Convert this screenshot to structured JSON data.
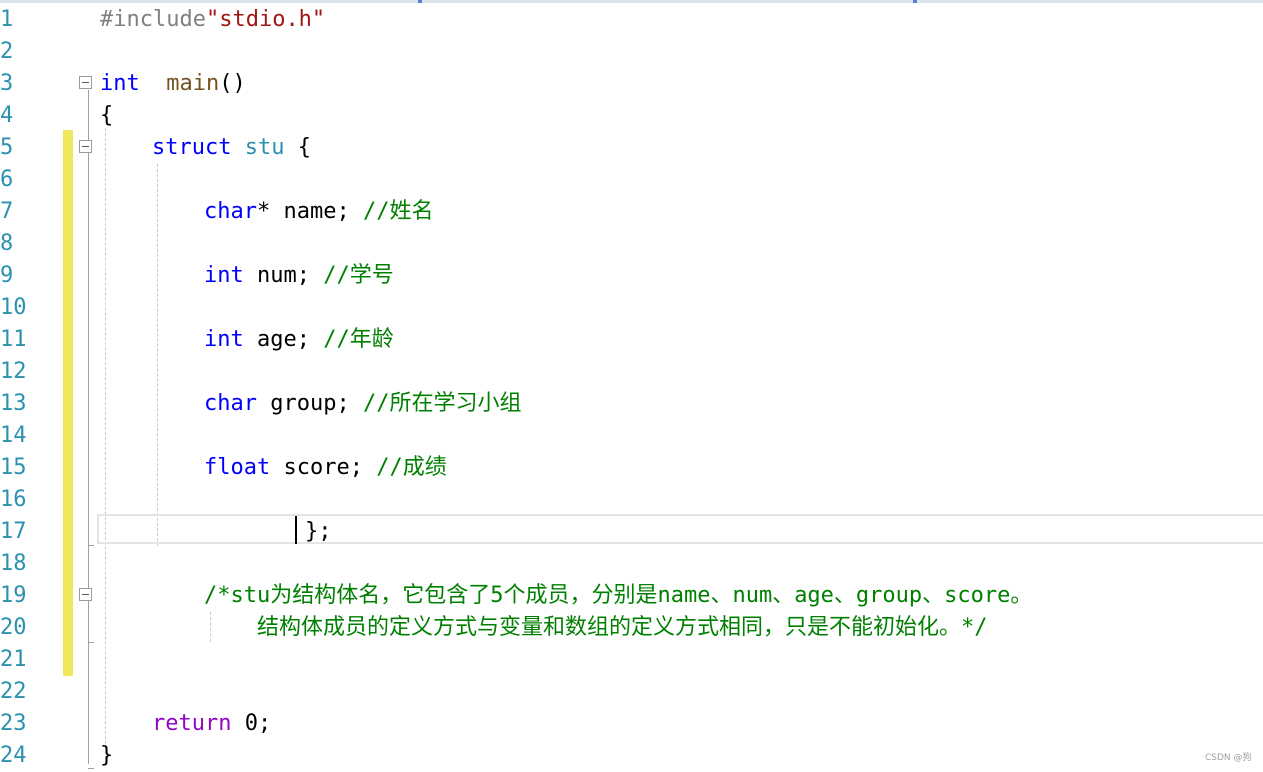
{
  "editor": {
    "line_numbers": [
      "1",
      "2",
      "3",
      "4",
      "5",
      "6",
      "7",
      "8",
      "9",
      "10",
      "11",
      "12",
      "13",
      "14",
      "15",
      "16",
      "17",
      "18",
      "19",
      "20",
      "21",
      "22",
      "23",
      "24"
    ],
    "l1": {
      "directive": "#include",
      "path": "\"stdio.h\""
    },
    "l3": {
      "type": "int",
      "func": "main",
      "parens": "()"
    },
    "l4": {
      "brace": "{"
    },
    "l5": {
      "kw": "struct",
      "name": "stu",
      "brace": "{"
    },
    "l7": {
      "type": "char",
      "rest": "* name; ",
      "comment": "//姓名"
    },
    "l9": {
      "type": "int",
      "rest": " num; ",
      "comment": "//学号"
    },
    "l11": {
      "type": "int",
      "rest": " age; ",
      "comment": "//年龄"
    },
    "l13": {
      "type": "char",
      "rest": " group; ",
      "comment": "//所在学习小组"
    },
    "l15": {
      "type": "float",
      "rest": " score; ",
      "comment": "//成绩"
    },
    "l17": {
      "text": "};"
    },
    "l19": {
      "comment": "/*stu为结构体名，它包含了5个成员，分别是name、num、age、group、score。"
    },
    "l20": {
      "comment": "结构体成员的定义方式与变量和数组的定义方式相同，只是不能初始化。*/"
    },
    "l23": {
      "kw": "return",
      "rest": " 0;"
    },
    "l24": {
      "brace": "}"
    }
  },
  "watermark": "CSDN @狗"
}
